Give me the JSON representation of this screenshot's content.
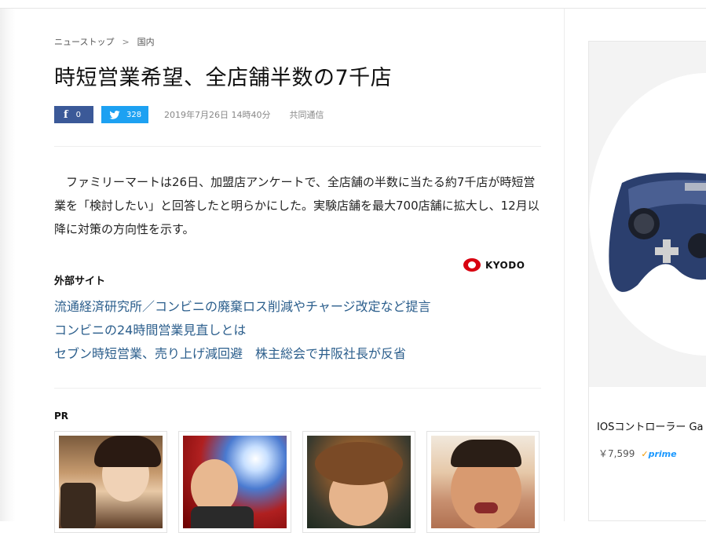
{
  "breadcrumb": {
    "items": [
      "ニューストップ",
      "国内"
    ],
    "separator": ">"
  },
  "article": {
    "title": "時短営業希望、全店舗半数の7千店",
    "facebook_count": "0",
    "twitter_count": "328",
    "date": "2019年7月26日 14時40分",
    "source": "共同通信",
    "body": "ファミリーマートは26日、加盟店アンケートで、全店舗の半数に当たる約7千店が時短営業を「検討したい」と回答したと明らかにした。実験店舗を最大700店舗に拡大し、12月以降に対策の方向性を示す。",
    "provider_logo_text": "KYODO"
  },
  "external": {
    "heading": "外部サイト",
    "links": [
      "流通経済研究所／コンビニの廃棄ロス削減やチャージ改定など提言",
      "コンビニの24時間営業見直しとは",
      "セブン時短営業、売り上げ減回避　株主総会で井阪社長が反省"
    ]
  },
  "pr": {
    "label": "PR"
  },
  "ad": {
    "title": "IOSコントローラー Ga",
    "price": "￥7,599",
    "prime_label": "prime"
  },
  "colors": {
    "facebook": "#3b5998",
    "twitter": "#1da1f2",
    "link": "#2b5e8c",
    "kyodo_red": "#d8000f"
  }
}
